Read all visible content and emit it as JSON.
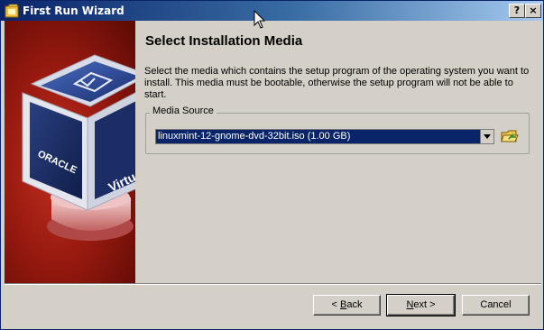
{
  "window": {
    "title": "First Run Wizard",
    "help_label": "?",
    "close_label": "×"
  },
  "page": {
    "heading": "Select Installation Media",
    "description": "Select the media which contains the setup program of the operating system you want to install. This media must be bootable, otherwise the setup program will not be able to start."
  },
  "media_source": {
    "legend": "Media Source",
    "selected_value": "linuxmint-12-gnome-dvd-32bit.iso (1.00 GB)"
  },
  "buttons": {
    "back_mnemonic": "B",
    "back_rest": "ack",
    "back_prefix": "< ",
    "next_mnemonic": "N",
    "next_rest": "ext >",
    "cancel": "Cancel"
  },
  "side_image": {
    "cube_text_left": "ORACLE",
    "cube_text_right": "Virtu"
  },
  "colors": {
    "titlebar_start": "#0a246a",
    "selection": "#0a246a",
    "dialog_bg": "#d4d0c8",
    "brand_red": "#9a1a10"
  },
  "icons": [
    "app-icon",
    "help-icon",
    "close-icon",
    "dropdown-arrow-icon",
    "open-folder-icon",
    "mouse-cursor-icon"
  ]
}
